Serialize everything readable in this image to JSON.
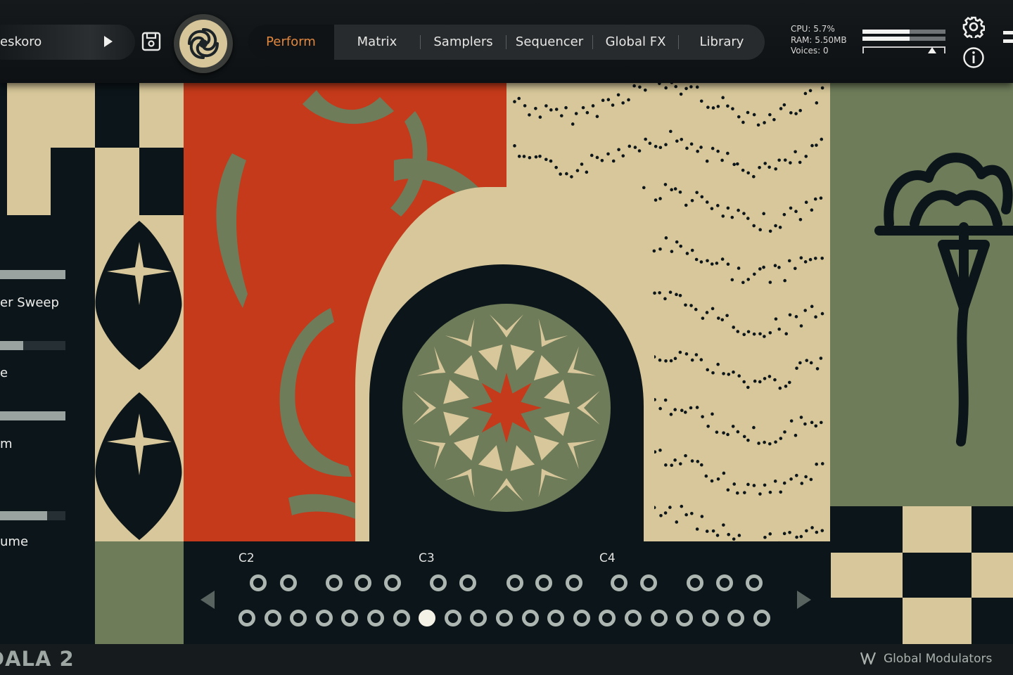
{
  "header": {
    "preset_name": "eskoro",
    "tabs": [
      {
        "label": "Perform",
        "active": true
      },
      {
        "label": "Matrix"
      },
      {
        "label": "Samplers"
      },
      {
        "label": "Sequencer"
      },
      {
        "label": "Global FX"
      },
      {
        "label": "Library"
      }
    ],
    "stats": {
      "cpu": "CPU: 5.7%",
      "ram": "RAM: 5.50MB",
      "voices": "Voices: 0"
    },
    "meters": {
      "level_top": 0.57,
      "level_bottom": 0.57,
      "thumb": 0.84
    }
  },
  "controls": [
    {
      "label": "",
      "value": 1.0
    },
    {
      "label": "er Sweep",
      "value": 0.35
    },
    {
      "label": "e",
      "value": 1.0
    },
    {
      "label": "m",
      "value": 0.72
    },
    {
      "label": "ume"
    }
  ],
  "keyboard": {
    "octaves": [
      "C2",
      "C3",
      "C4"
    ],
    "selected_index": 7
  },
  "footer": {
    "brand": "DALA 2",
    "global_modulators": "Global Modulators"
  },
  "colors": {
    "navy": "#0c1519",
    "beige": "#d7c79a",
    "red": "#c43a1a",
    "olive": "#6e7c5a",
    "accent": "#e2873f"
  }
}
